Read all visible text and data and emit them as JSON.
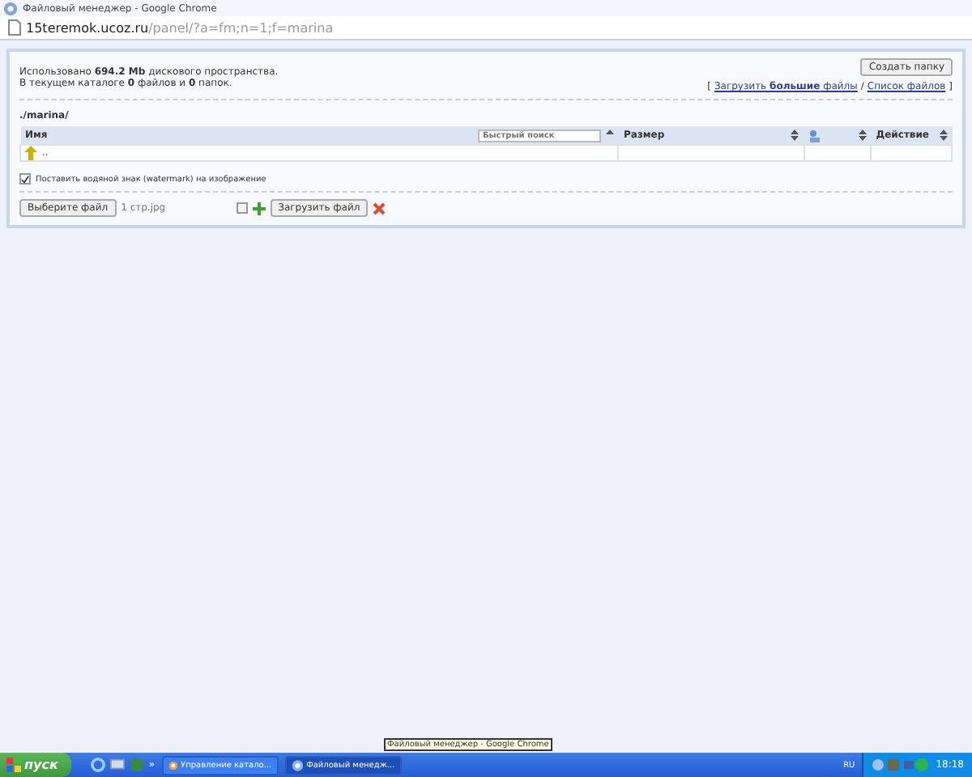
{
  "window": {
    "title": "Файловый менеджер - Google Chrome"
  },
  "address_bar": {
    "host": "15teremok.ucoz.ru",
    "path": "/panel/?a=fm;n=1;f=marina"
  },
  "info": {
    "line_1": "Использовано **694.2 Mb** дискового пространства.",
    "line_2": "В текущем каталоге **0** файлов и **0** папок."
  },
  "create_folder_button": "Создать папку",
  "links": {
    "open_bracket": "[",
    "upload_large": "Загрузить **большие** файлы",
    "separator": "/",
    "file_list": "Список файлов",
    "close_bracket": "]"
  },
  "path": "./marina/",
  "table": {
    "columns": [
      {
        "label": "Имя",
        "search_placeholder": "Быстрый поиск"
      },
      {
        "label": "Размер"
      },
      {},
      {
        "label": "Действие"
      }
    ],
    "rows": [
      {
        "name": ".."
      }
    ]
  },
  "watermark_option": {
    "label": "Поставить водяной знак (watermark) на изображение",
    "checked": true
  },
  "upload": {
    "choose_button": "Выберите файл",
    "file_name": "1 стр.jpg",
    "extra_checked": false,
    "upload_button": "Загрузить файл"
  },
  "taskbar": {
    "start": "пуск",
    "more": "»",
    "tasks": [
      {
        "label": "Управление катало...",
        "selected": false
      },
      {
        "label": "Файловый менедж...",
        "selected": true
      }
    ],
    "tooltip": "Файловый менеджер - Google Chrome",
    "language": "RU",
    "time": "18:18"
  }
}
